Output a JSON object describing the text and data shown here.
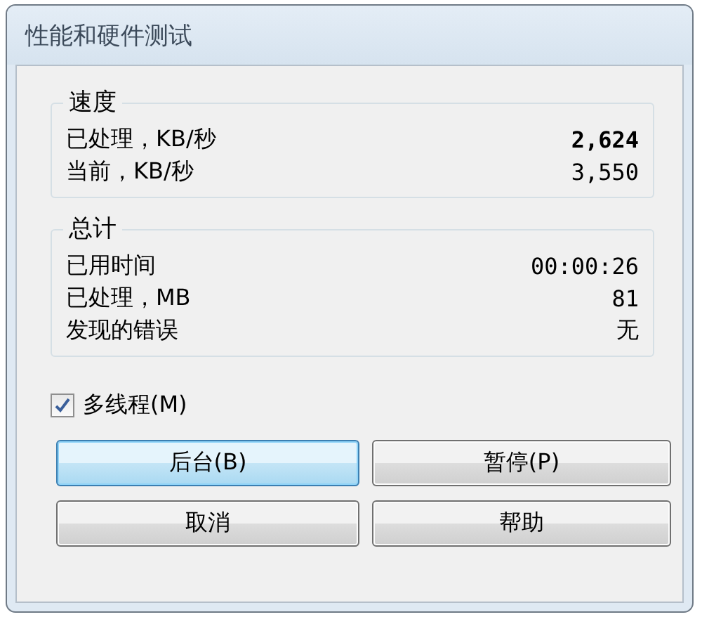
{
  "window": {
    "title": "性能和硬件测试"
  },
  "groups": [
    {
      "title": "速度",
      "rows": [
        {
          "label": "已处理，KB/秒",
          "value": "2,624",
          "bold": true
        },
        {
          "label": "当前，KB/秒",
          "value": "3,550",
          "bold": false
        }
      ]
    },
    {
      "title": "总计",
      "rows": [
        {
          "label": "已用时间",
          "value": "00:00:26",
          "bold": false
        },
        {
          "label": "已处理，MB",
          "value": "81",
          "bold": false
        },
        {
          "label": "发现的错误",
          "value": "无",
          "bold": false
        }
      ]
    }
  ],
  "multithread": {
    "label": "多线程(M)",
    "checked": true
  },
  "buttons": [
    {
      "label": "后台(B)",
      "focused": true
    },
    {
      "label": "暂停(P)",
      "focused": false
    },
    {
      "label": "取消",
      "focused": false
    },
    {
      "label": "帮助",
      "focused": false
    }
  ]
}
